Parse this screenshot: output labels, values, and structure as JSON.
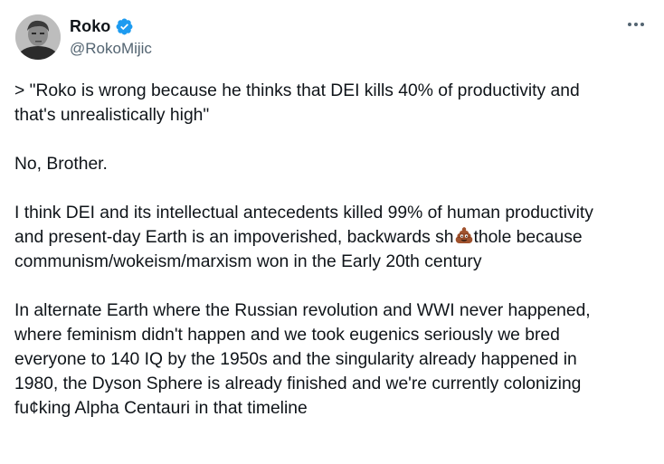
{
  "tweet": {
    "author": {
      "display_name": "Roko",
      "handle": "@RokoMijic",
      "verified": true
    },
    "more_icon": "more-dots-icon",
    "paragraphs": {
      "p1_line1": "> \"Roko is wrong because he thinks that DEI kills 40% of productivity and",
      "p1_line2": "that's unrealistically high\"",
      "p2": "No, Brother.",
      "p3_line1": "I think DEI and its intellectual antecedents killed 99% of human productivity",
      "p3_line2_before": "and present-day Earth is an impoverished, backwards sh",
      "p3_line2_emoji": "pile-of-poo-icon",
      "p3_line2_after": "thole because",
      "p3_line3": "communism/wokeism/marxism won in the Early 20th century",
      "p4_line1": "In alternate Earth where the Russian revolution and WWI never happened,",
      "p4_line2": "where feminism didn't happen and we took eugenics seriously we bred",
      "p4_line3": "everyone to 140 IQ by the 1950s and the singularity already happened in",
      "p4_line4": "1980, the Dyson Sphere is already finished and we're currently colonizing",
      "p4_line5": "fu¢king Alpha Centauri in that timeline"
    }
  },
  "colors": {
    "text": "#0f1419",
    "secondary": "#536471",
    "verified_blue": "#1d9bf0",
    "background": "#ffffff"
  }
}
